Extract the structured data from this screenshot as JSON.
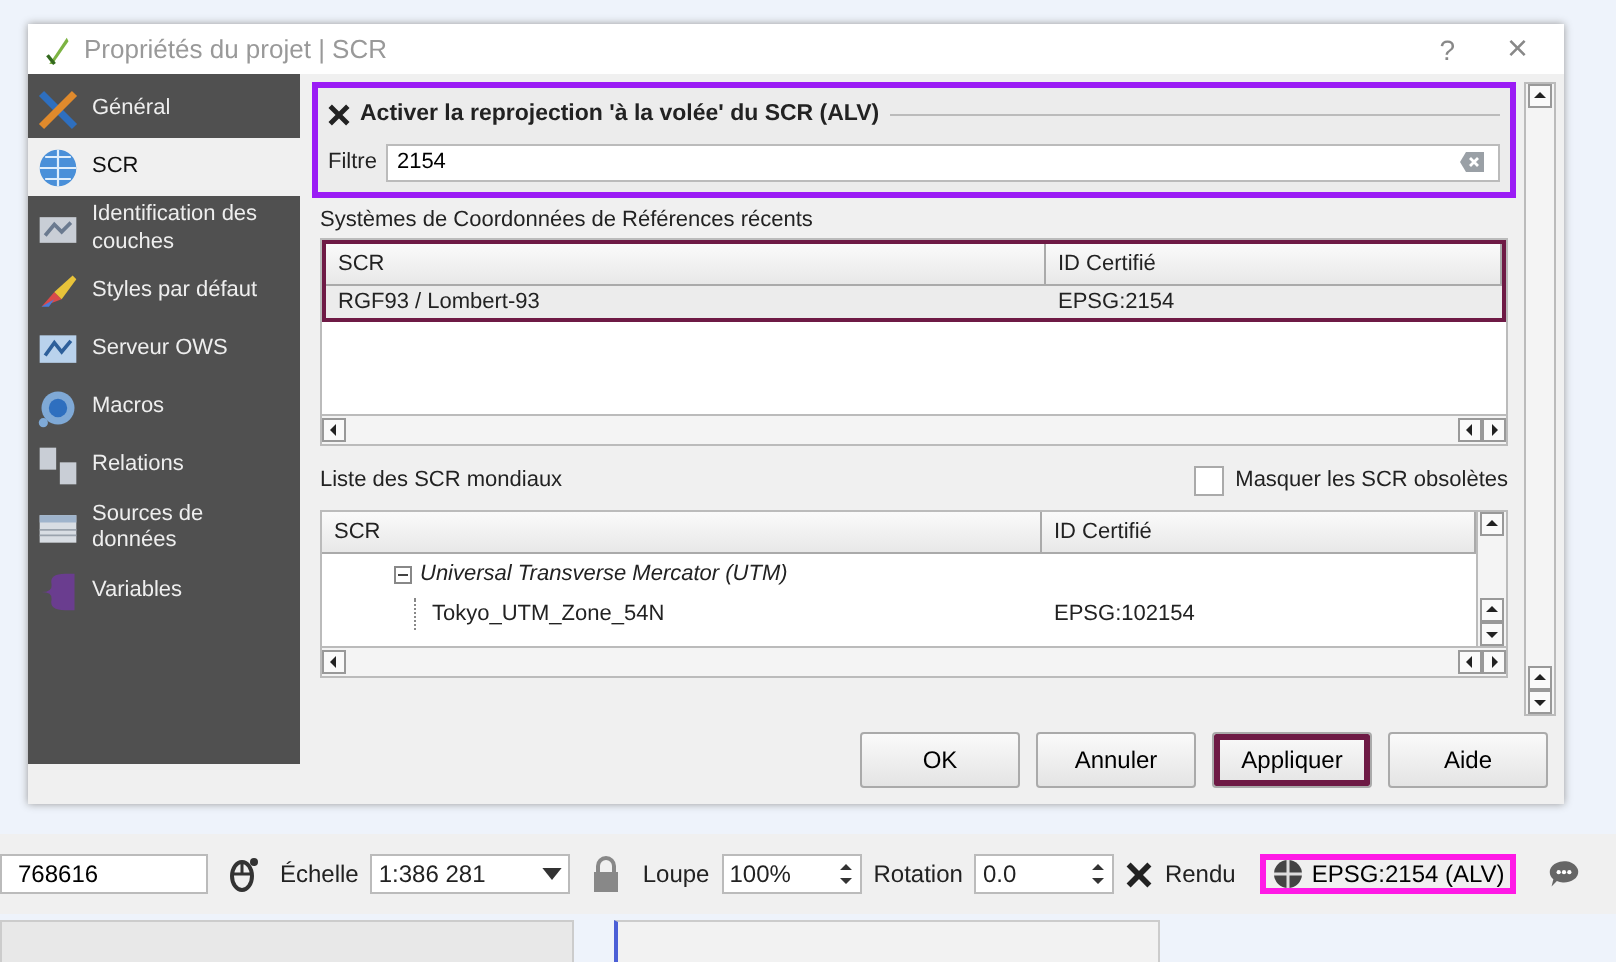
{
  "window": {
    "title": "Propriétés du projet | SCR",
    "help": "?",
    "close": "×"
  },
  "sidebar": {
    "items": [
      {
        "label": "Général",
        "selected": false
      },
      {
        "label": "SCR",
        "selected": true
      },
      {
        "label": "Identification des couches",
        "selected": false
      },
      {
        "label": "Styles par défaut",
        "selected": false
      },
      {
        "label": "Serveur OWS",
        "selected": false
      },
      {
        "label": "Macros",
        "selected": false
      },
      {
        "label": "Relations",
        "selected": false
      },
      {
        "label": "Sources de données",
        "selected": false
      },
      {
        "label": "Variables",
        "selected": false
      }
    ]
  },
  "reprojection": {
    "label": "Activer la reprojection 'à la volée' du SCR (ALV)",
    "checked": true,
    "highlighted": true,
    "filter_label": "Filtre",
    "filter_value": "2154"
  },
  "recent": {
    "title": "Systèmes de Coordonnées de Références récents",
    "highlighted": true,
    "columns": [
      "SCR",
      "ID Certifié"
    ],
    "rows": [
      {
        "cells": [
          "RGF93 / Lombert-93",
          "EPSG:2154"
        ]
      }
    ]
  },
  "world": {
    "title": "Liste des SCR mondiaux",
    "hide_obsolete": {
      "label": "Masquer les SCR obsolètes",
      "checked": false
    },
    "columns": [
      "SCR",
      "ID Certifié"
    ],
    "tree": [
      {
        "label": "Universal Transverse Mercator (UTM)",
        "expanded": true,
        "children": [
          {
            "label": "Tokyo_UTM_Zone_54N",
            "id": "EPSG:102154"
          }
        ]
      }
    ]
  },
  "buttons": [
    {
      "label": "OK",
      "highlighted": false
    },
    {
      "label": "Annuler",
      "highlighted": false
    },
    {
      "label": "Appliquer",
      "highlighted": true
    },
    {
      "label": "Aide",
      "highlighted": false
    }
  ],
  "status_bar": {
    "coordinate": "768616",
    "scale_label": "Échelle",
    "scale": "1:386 281",
    "magnifier_label": "Loupe",
    "magnifier": "100%",
    "rotation_label": "Rotation",
    "rotation": "0.0",
    "render": {
      "label": "Rendu",
      "checked": true
    },
    "crs": "EPSG:2154 (ALV)",
    "crs_highlighted": true
  }
}
